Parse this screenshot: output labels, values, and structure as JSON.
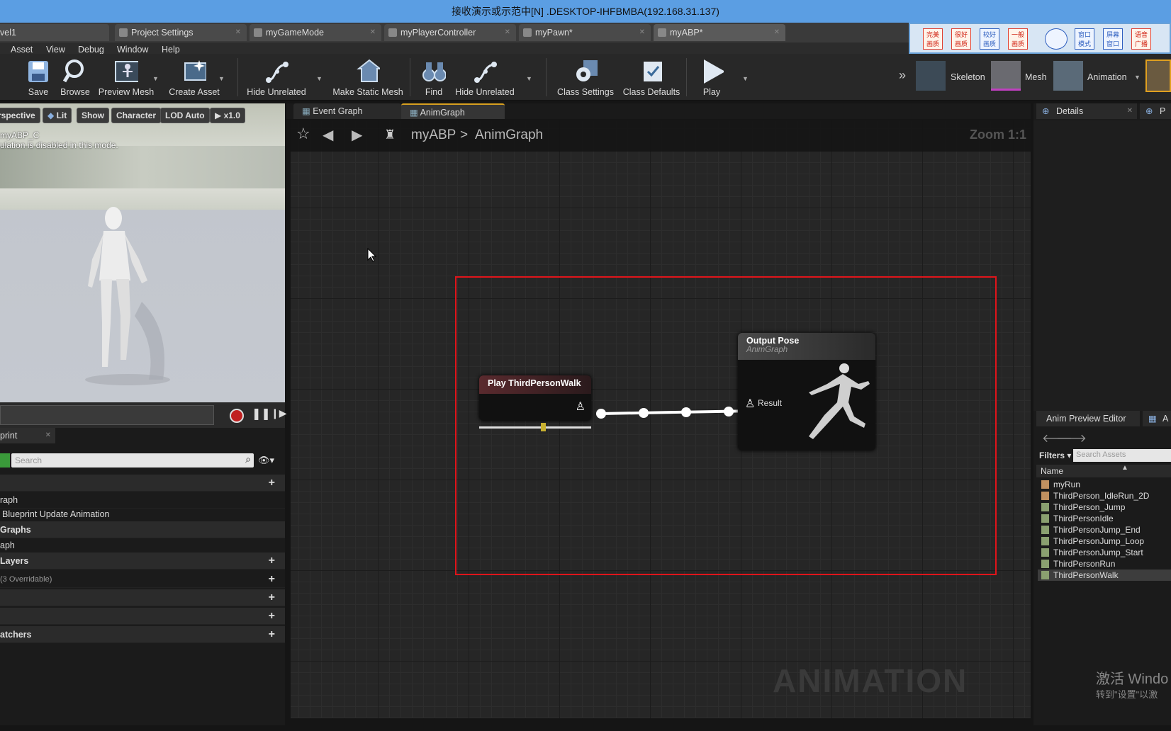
{
  "window": {
    "title": "接收演示或示范中[N] .DESKTOP-IHFBMBA(192.168.31.137)"
  },
  "doc_tabs": [
    {
      "label": "vel1"
    },
    {
      "label": "Project Settings"
    },
    {
      "label": "myGameMode"
    },
    {
      "label": "myPlayerController"
    },
    {
      "label": "myPawn*"
    },
    {
      "label": "myABP*"
    }
  ],
  "ime_toolbar": [
    "完美画质",
    "很好画质",
    "较好画质",
    "一般画质",
    "",
    "窗口模式",
    "屏幕窗口",
    "语音广播"
  ],
  "menu": [
    "Asset",
    "View",
    "Debug",
    "Window",
    "Help"
  ],
  "toolbar": {
    "save": "Save",
    "browse": "Browse",
    "preview_mesh": "Preview Mesh",
    "create_asset": "Create Asset",
    "hide_unrelated_1": "Hide Unrelated",
    "make_static_mesh": "Make Static Mesh",
    "find": "Find",
    "hide_unrelated_2": "Hide Unrelated",
    "class_settings": "Class Settings",
    "class_defaults": "Class Defaults",
    "play": "Play",
    "skeleton": "Skeleton",
    "mesh": "Mesh",
    "animation": "Animation"
  },
  "viewport": {
    "buttons": [
      "rspective",
      "Lit",
      "Show",
      "Character",
      "LOD Auto",
      "x1.0"
    ],
    "overlay_line1": "myABP_C",
    "overlay_line2": "ulation is disabled in this mode."
  },
  "left_panel": {
    "tab": "print",
    "search_placeholder": "Search",
    "rows": [
      {
        "text": "",
        "header": true,
        "plus": true
      },
      {
        "text": "raph",
        "header": false,
        "plus": false
      },
      {
        "text": "Blueprint Update Animation",
        "header": false,
        "plus": false
      },
      {
        "text": "Graphs",
        "header": true,
        "plus": false
      },
      {
        "text": "aph",
        "header": false,
        "plus": false
      },
      {
        "text": "Layers",
        "header": true,
        "plus": true
      },
      {
        "text": "(3 Overridable)",
        "header": false,
        "plus": true
      },
      {
        "text": "",
        "header": false,
        "plus": true
      },
      {
        "text": "",
        "header": false,
        "plus": true
      },
      {
        "text": "atchers",
        "header": true,
        "plus": true
      }
    ]
  },
  "graph": {
    "tabs": [
      "Event Graph",
      "AnimGraph"
    ],
    "breadcrumb_root": "myABP",
    "breadcrumb_sep": ">",
    "breadcrumb_leaf": "AnimGraph",
    "zoom": "Zoom 1:1",
    "play_node_title": "Play ThirdPersonWalk",
    "output_node_title": "Output Pose",
    "output_node_subtitle": "AnimGraph",
    "result_label": "Result",
    "watermark": "ANIMATION"
  },
  "right": {
    "details_tab": "Details",
    "details_tab2": "P",
    "preview_tab": "Anim Preview Editor",
    "preview_tab2": "A",
    "filters": "Filters",
    "search_placeholder": "Search Assets",
    "name_col": "Name",
    "assets": [
      "myRun",
      "ThirdPerson_IdleRun_2D",
      "ThirdPerson_Jump",
      "ThirdPersonIdle",
      "ThirdPersonJump_End",
      "ThirdPersonJump_Loop",
      "ThirdPersonJump_Start",
      "ThirdPersonRun",
      "ThirdPersonWalk"
    ],
    "selected_asset": "ThirdPersonWalk"
  },
  "os_watermark": {
    "line1": "激活 Windo",
    "line2": "转到\"设置\"以激"
  },
  "colors": {
    "title_bar": "#5b9ee3",
    "selection_box": "#e0141a",
    "play_node_header": "#5a2a2e",
    "output_node_header": "#4a4a4a",
    "tab_accent": "#d8a020"
  }
}
